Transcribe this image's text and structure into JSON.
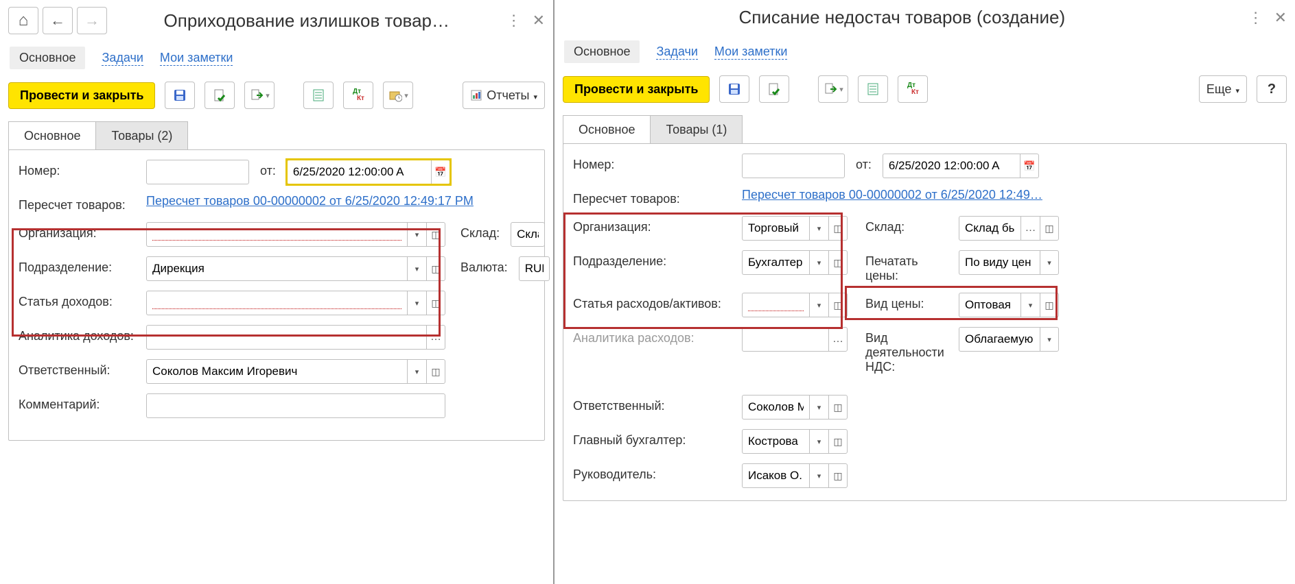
{
  "left": {
    "title": "Оприходование излишков товар…",
    "nav": {
      "main": "Основное",
      "tasks": "Задачи",
      "notes": "Мои заметки"
    },
    "toolbar": {
      "post_close": "Провести и закрыть",
      "reports": "Отчеты"
    },
    "tabs": {
      "main": "Основное",
      "goods": "Товары (2)"
    },
    "fields": {
      "number_label": "Номер:",
      "number_value": "",
      "from_label": "от:",
      "from_value": "6/25/2020 12:00:00 A",
      "recount_label": "Пересчет товаров:",
      "recount_link": "Пересчет товаров 00-00000002 от 6/25/2020 12:49:17 PM",
      "org_label": "Организация:",
      "org_value": "",
      "dept_label": "Подразделение:",
      "dept_value": "Дирекция",
      "income_label": "Статья доходов:",
      "income_value": "",
      "analytics_label": "Аналитика доходов:",
      "analytics_value": "",
      "resp_label": "Ответственный:",
      "resp_value": "Соколов Максим Игоревич",
      "comment_label": "Комментарий:",
      "comment_value": "",
      "warehouse_label": "Склад:",
      "warehouse_value": "Скла",
      "currency_label": "Валюта:",
      "currency_value": "RUB"
    }
  },
  "right": {
    "title": "Списание недостач товаров (создание)",
    "nav": {
      "main": "Основное",
      "tasks": "Задачи",
      "notes": "Мои заметки"
    },
    "toolbar": {
      "post_close": "Провести и закрыть",
      "more": "Еще"
    },
    "tabs": {
      "main": "Основное",
      "goods": "Товары (1)"
    },
    "fields": {
      "number_label": "Номер:",
      "number_value": "",
      "from_label": "от:",
      "from_value": "6/25/2020 12:00:00 A",
      "recount_label": "Пересчет товаров:",
      "recount_link": "Пересчет товаров 00-00000002 от 6/25/2020 12:49…",
      "org_label": "Организация:",
      "org_value": "Торговый",
      "dept_label": "Подразделение:",
      "dept_value": "Бухгалтер",
      "expense_label": "Статья расходов/активов:",
      "expense_value": "",
      "analytics_label": "Аналитика расходов:",
      "analytics_value": "",
      "resp_label": "Ответственный:",
      "resp_value": "Соколов М",
      "chief_acc_label": "Главный бухгалтер:",
      "chief_acc_value": "Кострова",
      "head_label": "Руководитель:",
      "head_value": "Исаков О.",
      "warehouse_label": "Склад:",
      "warehouse_value": "Склад бы",
      "print_prices_label": "Печатать цены:",
      "print_prices_value": "По виду цен",
      "price_type_label": "Вид цены:",
      "price_type_value": "Оптовая",
      "vat_label": "Вид деятельности НДС:",
      "vat_value": "Облагаемую"
    }
  }
}
